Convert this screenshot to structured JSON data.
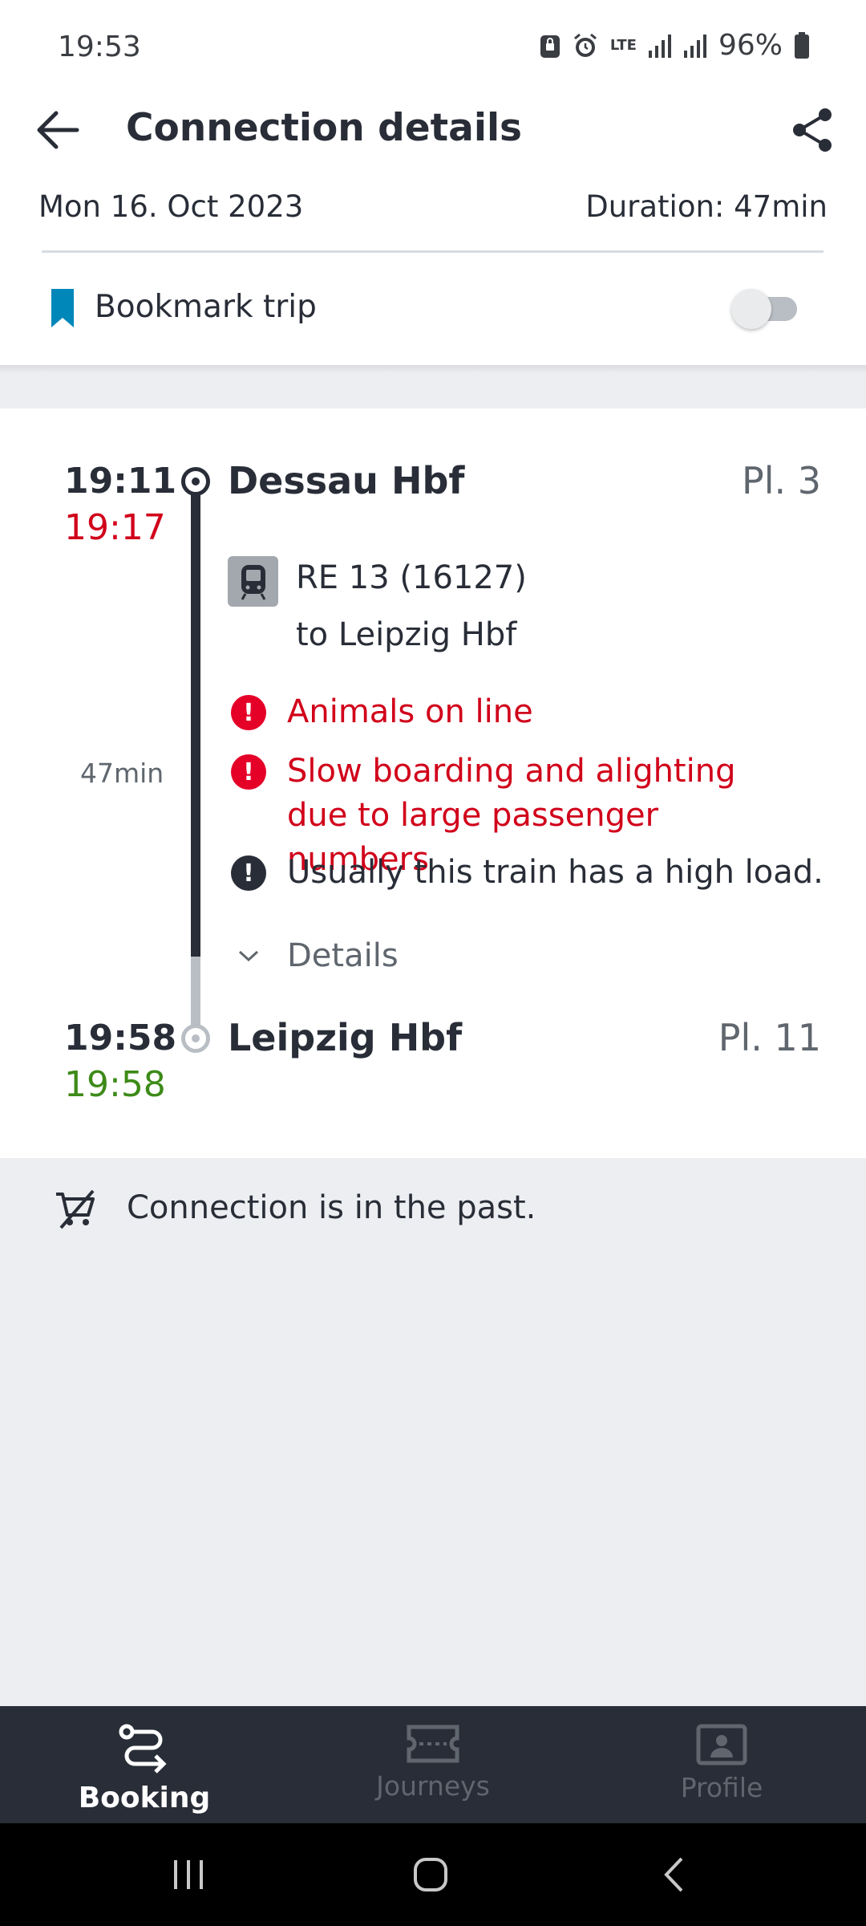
{
  "status_bar": {
    "time": "19:53",
    "network": "LTE",
    "battery": "96%",
    "icons": [
      "vpn-lock-icon",
      "alarm-icon",
      "lte-icon",
      "signal-icon",
      "signal-icon",
      "battery-icon"
    ]
  },
  "header": {
    "title": "Connection details",
    "back_icon": "arrow-left-icon",
    "share_icon": "share-icon"
  },
  "trip_info": {
    "date": "Mon 16. Oct 2023",
    "duration": "Duration: 47min"
  },
  "bookmark": {
    "label": "Bookmark trip",
    "enabled": false,
    "accent": "#0087b9"
  },
  "journey": {
    "departure": {
      "planned_time": "19:11",
      "realtime": "19:17",
      "station": "Dessau Hbf",
      "platform": "Pl. 3"
    },
    "train": {
      "name": "RE 13 (16127)",
      "destination": "to Leipzig Hbf",
      "icon": "regional-train-icon"
    },
    "leg_duration": "47min",
    "messages": [
      {
        "text": "Animals on line",
        "severity": "error"
      },
      {
        "text": "Slow boarding and alighting due to large passenger numbers",
        "severity": "error"
      },
      {
        "text": "Usually this train has a high load.",
        "severity": "info"
      }
    ],
    "details_label": "Details",
    "arrival": {
      "planned_time": "19:58",
      "realtime": "19:58",
      "station": "Leipzig Hbf",
      "platform": "Pl. 11"
    }
  },
  "notice": {
    "text": "Connection is in the past.",
    "icon": "cart-crossed-icon"
  },
  "bottom_nav": {
    "items": [
      {
        "label": "Booking",
        "icon": "route-icon",
        "active": true
      },
      {
        "label": "Journeys",
        "icon": "ticket-icon",
        "active": false
      },
      {
        "label": "Profile",
        "icon": "profile-card-icon",
        "active": false
      }
    ]
  },
  "colors": {
    "delay": "#d1001a",
    "on_time": "#3d8a18",
    "dark": "#282d37",
    "muted": "#5f666e",
    "background_gray": "#eceef1"
  }
}
